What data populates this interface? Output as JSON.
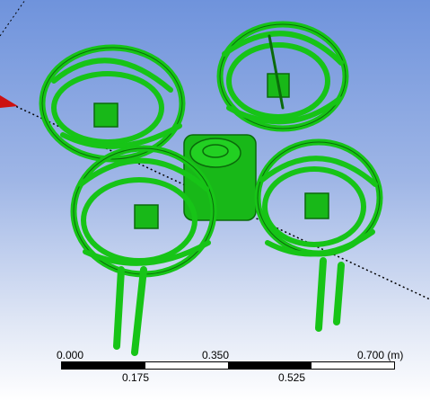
{
  "viewport": {
    "background_top": "#6f93dc",
    "background_bottom": "#ffffff",
    "model_color": "#17c417",
    "model_edge_color": "#0a6a0a",
    "axis_line_color": "#000000",
    "axis_marker_color": "#cc0000"
  },
  "scale_bar": {
    "top_labels": [
      "0.000",
      "0.350",
      "0.700 (m)"
    ],
    "bottom_labels": [
      "0.175",
      "0.525"
    ],
    "segments": [
      "black",
      "white",
      "black",
      "white"
    ]
  }
}
